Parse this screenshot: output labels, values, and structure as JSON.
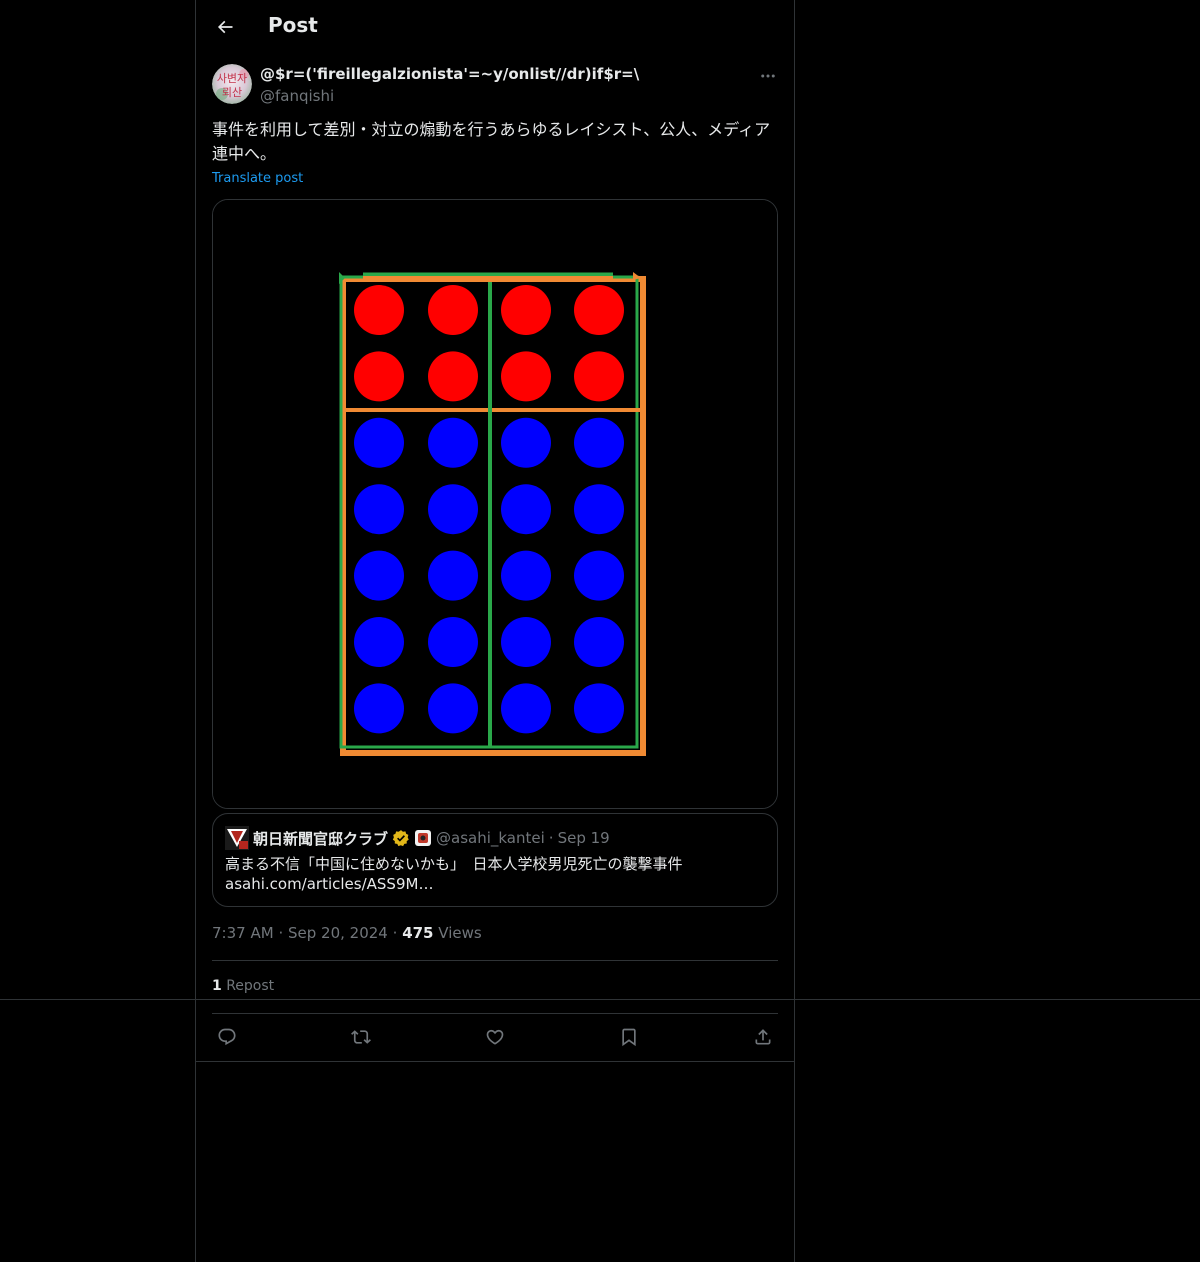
{
  "header": {
    "title": "Post",
    "back_icon": "arrow-left-icon"
  },
  "author": {
    "display_name": "@$r=('fireillegalzionista'=~y/onlist//dr)if$r=\\",
    "handle": "@fanqishi",
    "avatar_text_1": "사변자",
    "avatar_text_2": "뢰산"
  },
  "post": {
    "text": "事件を利用して差別・対立の煽動を行うあらゆるレイシスト、公人、メディア連中へ。",
    "translate_label": "Translate post"
  },
  "media": {
    "description_icon": "image-icon",
    "top_rows": 2,
    "bottom_rows": 5,
    "columns": 4,
    "top_color": "#ff0000",
    "bottom_color": "#0000ff",
    "frame_orange": "#f08a33",
    "frame_green": "#2aa84a"
  },
  "quote": {
    "name": "朝日新聞官邸クラブ",
    "handle": "@asahi_kantei",
    "dot": "·",
    "date": "Sep 19",
    "line1": "高まる不信「中国に住めないかも」　日本人学校男児死亡の襲撃事件",
    "line2": "asahi.com/articles/ASS9M…"
  },
  "meta": {
    "time": "7:37 AM",
    "dot1": "·",
    "date": "Sep 20, 2024",
    "dot2": "·",
    "views_count": "475",
    "views_label": "Views"
  },
  "reposts": {
    "count": "1",
    "label": "Repost"
  },
  "colors": {
    "accent": "#1d9bf0",
    "muted": "#71767b",
    "border": "#2f3336",
    "text": "#e7e9ea",
    "verified": "#e2b719"
  }
}
